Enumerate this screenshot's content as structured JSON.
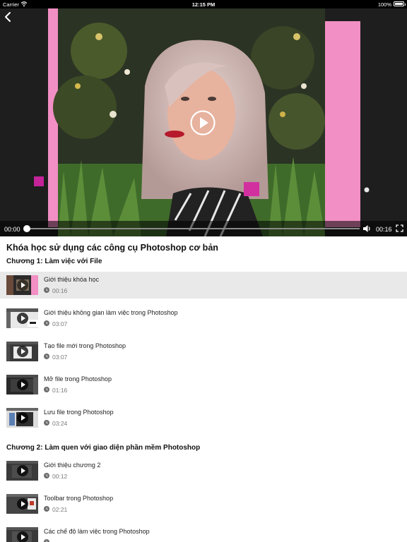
{
  "status_bar": {
    "carrier": "Carrier",
    "time": "12:15 PM",
    "battery": "100%"
  },
  "player": {
    "current_time": "00:00",
    "duration": "00:16",
    "progress": 0
  },
  "course": {
    "title": "Khóa học sử dụng các công cụ Photoshop cơ bản",
    "chapters": [
      {
        "title": "Chương 1: Làm việc với File",
        "lessons": [
          {
            "title": "Giới thiệu khóa học",
            "duration": "00:16",
            "active": true
          },
          {
            "title": "Giới thiệu không gian làm việc trong Photoshop",
            "duration": "03:07"
          },
          {
            "title": "Tạo file mới trong Photoshop",
            "duration": "03:07"
          },
          {
            "title": "Mở file trong Photoshop",
            "duration": "01:16"
          },
          {
            "title": "Lưu file trong Photoshop",
            "duration": "03:24"
          }
        ]
      },
      {
        "title": "Chương 2: Làm quen với giao diện phần mềm Photoshop",
        "lessons": [
          {
            "title": "Giới thiệu chương 2",
            "duration": "00:12"
          },
          {
            "title": "Toolbar trong Photoshop",
            "duration": "02:21"
          },
          {
            "title": "Các chế độ làm việc trong Photoshop",
            "duration": ""
          }
        ]
      }
    ]
  },
  "colors": {
    "accent_pink": "#f28fc4",
    "active_row": "#e9e9e9"
  }
}
